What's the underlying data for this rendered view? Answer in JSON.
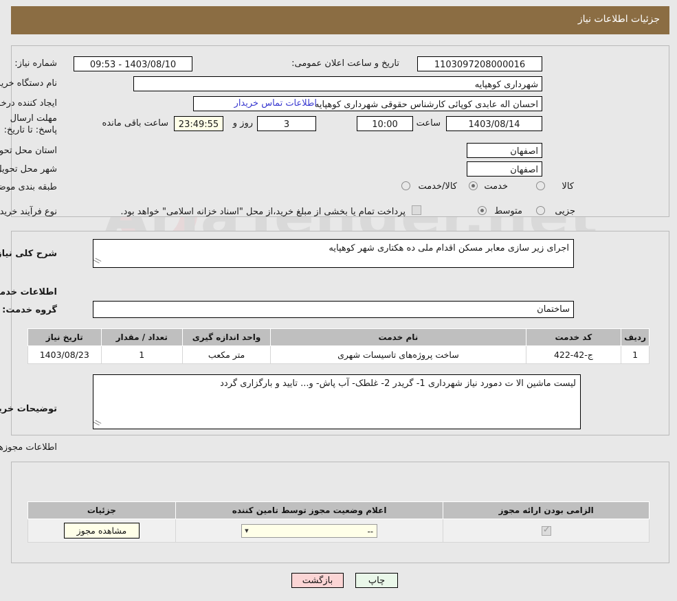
{
  "header": {
    "title": "جزئیات اطلاعات نیاز"
  },
  "top_section": {
    "need_number_label": "شماره نیاز:",
    "need_number_value": "1103097208000016",
    "announce_label": "تاریخ و ساعت اعلان عمومی:",
    "announce_value": "1403/08/10 - 09:53",
    "buyer_org_label": "نام دستگاه خریدار:",
    "buyer_org_value": "شهرداری کوهپایه",
    "creator_label": "ایجاد کننده درخواست:",
    "creator_value": "احسان اله عابدی کوپائی کارشناس حقوقی شهرداری کوهپایه",
    "contact_link": "اطلاعات تماس خریدار",
    "deadline_label": "مهلت ارسال پاسخ: تا تاریخ:",
    "deadline_date": "1403/08/14",
    "hour_label": "ساعت",
    "deadline_hour": "10:00",
    "days_value": "3",
    "days_label": "روز و",
    "timer_value": "23:49:55",
    "timer_label": "ساعت باقی مانده",
    "province_label": "استان محل تحویل:",
    "province_value": "اصفهان",
    "city_label": "شهر محل تحویل:",
    "city_value": "اصفهان",
    "category_label": "طبقه بندی موضوعی:",
    "category_options": [
      "کالا",
      "خدمت",
      "کالا/خدمت"
    ],
    "category_selected": "خدمت",
    "process_label": "نوع فرآیند خرید :",
    "process_options": [
      "جزیی",
      "متوسط"
    ],
    "process_selected": "متوسط",
    "treasury_note": "پرداخت تمام یا بخشی از مبلغ خرید،از محل \"اسناد خزانه اسلامی\" خواهد بود.",
    "treasury_checked": false
  },
  "mid_section": {
    "general_desc_label": "شرح کلی نیاز:",
    "general_desc_value": "اجرای زیر سازی معابر مسکن اقدام ملی ده هکتاری  شهر کوهپایه",
    "services_info_caption": "اطلاعات خدمات مورد نیاز",
    "service_group_label": "گروه خدمت:",
    "service_group_value": "ساختمان",
    "table": {
      "headers": [
        "ردیف",
        "کد خدمت",
        "نام خدمت",
        "واحد اندازه گیری",
        "تعداد / مقدار",
        "تاریخ نیاز"
      ],
      "rows": [
        {
          "row": "1",
          "service_code": "ج-42-422",
          "service_name": "ساخت پروژه‌های تاسیسات شهری",
          "unit": "متر مکعب",
          "quantity": "1",
          "need_date": "1403/08/23"
        }
      ]
    },
    "buyer_notes_label": "توضیحات خریدار:",
    "buyer_notes_value": "لیست ماشین الا ت دمورد نیاز شهرداری 1- گریدر 2- غلطک- آب پاش- و... تایید و بارگزاری گردد"
  },
  "permits_section": {
    "caption": "اطلاعات مجوزهای ارائه خدمت / کالا",
    "table": {
      "headers": [
        "الزامی بودن ارائه مجوز",
        "اعلام وضعیت مجوز توسط تامین کننده",
        "جزئیات"
      ],
      "rows": [
        {
          "required": true,
          "status_value": "--",
          "details_button": "مشاهده مجوز"
        }
      ]
    }
  },
  "footer": {
    "print_label": "چاپ",
    "back_label": "بازگشت"
  },
  "watermark": {
    "text": "AriaTender.net"
  },
  "colors": {
    "header_brown": "#8b6d43",
    "page_bg": "#e8e8e8",
    "link_blue": "#3a3ad0",
    "table_header_gray": "#bfbfbf",
    "timer_cream": "#ffffe8",
    "print_green": "#e9f7e9",
    "back_pink": "#fbd5d5"
  }
}
